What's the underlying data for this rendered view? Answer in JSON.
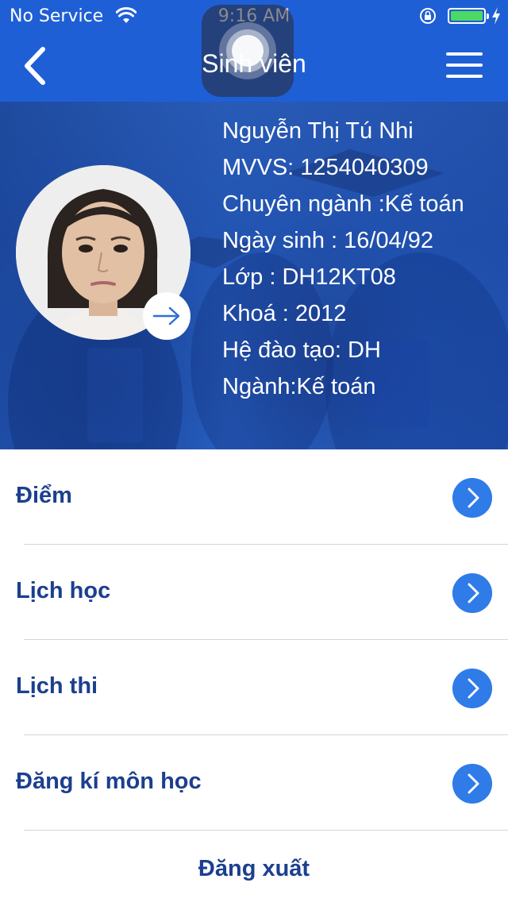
{
  "status_bar": {
    "carrier": "No Service",
    "time": "9:16 AM",
    "wifi_icon": "wifi-icon",
    "lock_icon": "rotation-lock-icon",
    "battery_level": 1.0,
    "battery_color": "#4cd964",
    "charging_icon": "bolt-icon"
  },
  "nav": {
    "title": "Sinh viên",
    "back_icon": "chevron-left-icon",
    "menu_icon": "hamburger-icon",
    "background": "#1f5fd6"
  },
  "profile": {
    "name": "Nguyễn Thị Tú Nhi",
    "student_id": "MVVS: 1254040309",
    "major": "Chuyên ngành :Kế toán",
    "birthdate": "Ngày sinh : 16/04/92",
    "class": "Lớp : DH12KT08",
    "cohort": "Khoá : 2012",
    "training_system": "Hệ đào tạo: DH",
    "field": "Ngành:Kế toán",
    "avatar_action_icon": "arrow-right-icon"
  },
  "menu": {
    "items": [
      {
        "label": "Điểm",
        "icon": "chevron-right-circle-icon"
      },
      {
        "label": "Lịch học",
        "icon": "chevron-right-circle-icon"
      },
      {
        "label": "Lịch thi",
        "icon": "chevron-right-circle-icon"
      },
      {
        "label": "Đăng kí môn học",
        "icon": "chevron-right-circle-icon"
      }
    ],
    "accent_color": "#2f7be8",
    "label_color": "#1c3f8f"
  },
  "logout_label": "Đăng xuất"
}
